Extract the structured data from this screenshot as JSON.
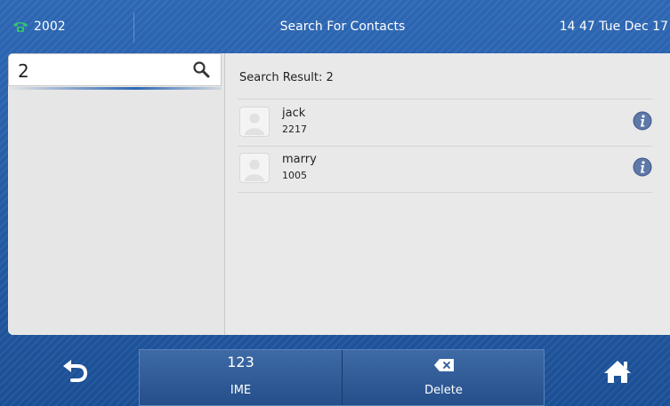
{
  "status_bar": {
    "line_label": "2002",
    "title": "Search For Contacts",
    "clock": "14 47 Tue Dec 17",
    "accent_color": "#34c36b"
  },
  "search": {
    "value": "2"
  },
  "results": {
    "header": "Search Result: 2",
    "contacts": [
      {
        "name": "jack",
        "number": "2217"
      },
      {
        "name": "marry",
        "number": "1005"
      }
    ]
  },
  "softkeys": {
    "ime_top": "123",
    "ime_label": "IME",
    "delete_label": "Delete"
  },
  "icons": {
    "line": "phone-icon",
    "search": "search-icon",
    "contact_avatar": "avatar-icon",
    "detail": "info-icon",
    "back": "back-icon",
    "delete": "backspace-icon",
    "home": "home-icon"
  }
}
